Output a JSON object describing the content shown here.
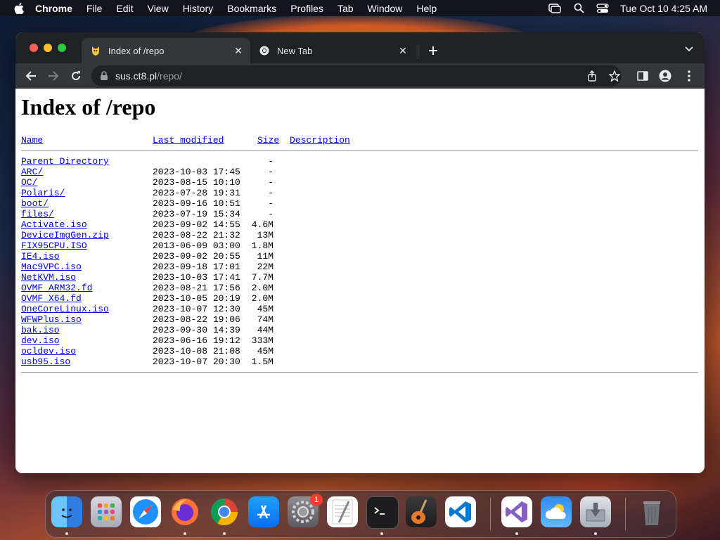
{
  "menubar": {
    "app_name": "Chrome",
    "items": [
      "File",
      "Edit",
      "View",
      "History",
      "Bookmarks",
      "Profiles",
      "Tab",
      "Window",
      "Help"
    ],
    "clock": "Tue Oct 10  4:25 AM"
  },
  "browser": {
    "tabs": [
      {
        "title": "Index of /repo",
        "active": true
      },
      {
        "title": "New Tab",
        "active": false
      }
    ],
    "url_host": "sus.ct8.pl",
    "url_path": "/repo/"
  },
  "page": {
    "title": "Index of /repo",
    "headers": {
      "name": "Name",
      "modified": "Last modified",
      "size": "Size",
      "description": "Description"
    },
    "rows": [
      {
        "name": "Parent Directory",
        "modified": "",
        "size": "-"
      },
      {
        "name": "ARC/",
        "modified": "2023-10-03 17:45",
        "size": "-"
      },
      {
        "name": "OC/",
        "modified": "2023-08-15 10:10",
        "size": "-"
      },
      {
        "name": "Polaris/",
        "modified": "2023-07-28 19:31",
        "size": "-"
      },
      {
        "name": "boot/",
        "modified": "2023-09-16 10:51",
        "size": "-"
      },
      {
        "name": "files/",
        "modified": "2023-07-19 15:34",
        "size": "-"
      },
      {
        "name": "Activate.iso",
        "modified": "2023-09-02 14:55",
        "size": "4.6M"
      },
      {
        "name": "DeviceImgGen.zip",
        "modified": "2023-08-22 21:32",
        "size": "13M"
      },
      {
        "name": "FIX95CPU.ISO",
        "modified": "2013-06-09 03:00",
        "size": "1.8M"
      },
      {
        "name": "IE4.iso",
        "modified": "2023-09-02 20:55",
        "size": "11M"
      },
      {
        "name": "Mac9VPC.iso",
        "modified": "2023-09-18 17:01",
        "size": "22M"
      },
      {
        "name": "NetKVM.iso",
        "modified": "2023-10-03 17:41",
        "size": "7.7M"
      },
      {
        "name": "OVMF_ARM32.fd",
        "modified": "2023-08-21 17:56",
        "size": "2.0M"
      },
      {
        "name": "OVMF_X64.fd",
        "modified": "2023-10-05 20:19",
        "size": "2.0M"
      },
      {
        "name": "OneCoreLinux.iso",
        "modified": "2023-10-07 12:30",
        "size": "45M"
      },
      {
        "name": "WFWPlus.iso",
        "modified": "2023-08-22 19:06",
        "size": "74M"
      },
      {
        "name": "bak.iso",
        "modified": "2023-09-30 14:39",
        "size": "44M"
      },
      {
        "name": "dev.iso",
        "modified": "2023-06-16 19:12",
        "size": "333M"
      },
      {
        "name": "ocldev.iso",
        "modified": "2023-10-08 21:08",
        "size": "45M"
      },
      {
        "name": "usb95.iso",
        "modified": "2023-10-07 20:30",
        "size": "1.5M"
      }
    ]
  },
  "dock": {
    "apps": [
      "finder-icon",
      "launchpad-icon",
      "safari-icon",
      "firefox-icon",
      "chrome-icon",
      "app-store-icon",
      "system-settings-icon",
      "textedit-icon",
      "terminal-icon",
      "garageband-icon",
      "vscode-icon",
      "visual-studio-icon",
      "weather-icon",
      "installer-icon",
      "trash-icon"
    ],
    "settings_badge": "1"
  }
}
